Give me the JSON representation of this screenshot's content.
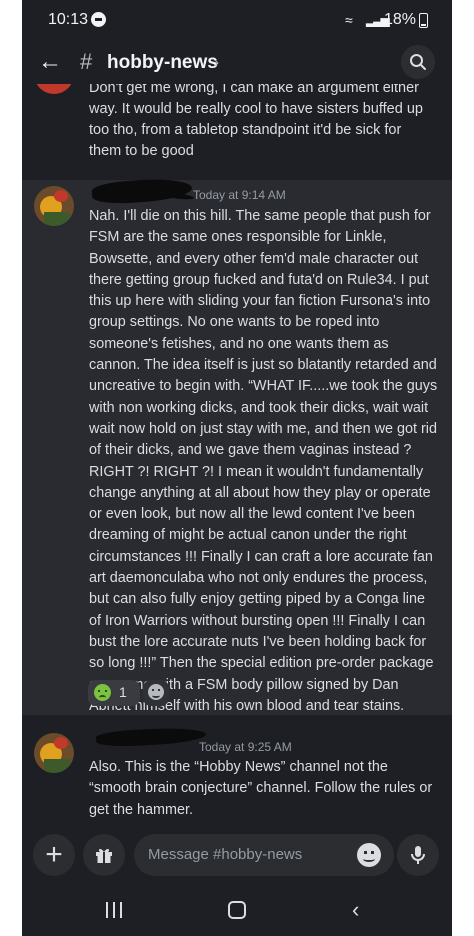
{
  "status_bar": {
    "time": "10:13",
    "battery": "18%"
  },
  "header": {
    "channel_hash": "#",
    "channel_name": "hobby-news",
    "chevron": "›"
  },
  "messages": [
    {
      "text": "Don't get me wrong, I can make an argument either way. It would be really cool to have sisters buffed up too tho, from a tabletop standpoint it'd be sick for them to be good"
    },
    {
      "timestamp": "Today at 9:14 AM",
      "text": "Nah. I'll die on this hill. The same people that push for FSM are the same ones responsible for Linkle, Bowsette, and every other fem'd male character out there getting group fucked and futa'd on Rule34. I put this up here with sliding your fan fiction Fursona's into group settings. No one wants to be roped into someone's  fetishes, and no one wants them as cannon. The idea itself is just so blatantly retarded and uncreative to begin with. “WHAT IF.....we took the guys with non working dicks, and took their dicks, wait wait wait now hold on just stay with me, and then we got rid of their dicks, and we gave them vaginas instead ? RIGHT ?! RIGHT ?! I mean it wouldn't fundamentally change anything at all about how they play or operate or even look, but now all the lewd content I've been dreaming of might be actual canon under the right circumstances !!! Finally I can craft a lore accurate fan art daemonculaba who not only endures the process, but can also fully enjoy getting piped by a Conga line of Iron Warriors without bursting open !!! Finally I can bust the lore accurate nuts I've been holding back for so long !!!” Then the special edition pre-order package can come with a FSM body pillow signed by Dan Abnett himself with his own blood and tear stains.",
      "reaction_count": "1"
    },
    {
      "timestamp": "Today at 9:25 AM",
      "text": "Also. This is the “Hobby News” channel not the “smooth brain conjecture” channel. Follow the rules or get the hammer."
    }
  ],
  "composer": {
    "placeholder": "Message #hobby-news"
  },
  "colors": {
    "background": "#1e1f24",
    "highlight_row": "#2a2b31",
    "text": "#dcdde1",
    "muted": "#949ba4"
  }
}
